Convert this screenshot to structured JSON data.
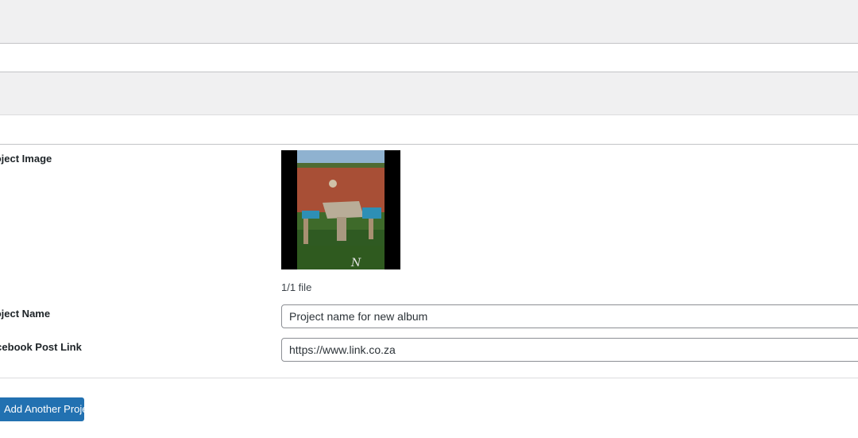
{
  "form": {
    "project_image_label": "Project Image",
    "file_count": "1/1 file",
    "project_name_label": "Project Name",
    "project_name_value": "Project name for new album",
    "facebook_link_label": "Facebook Post Link",
    "facebook_link_value": "https://www.link.co.za",
    "add_button_label": "Add Another Project"
  },
  "colors": {
    "accent": "#2271b1",
    "band": "#f0f0f1",
    "border": "#c3c4c7"
  },
  "icons": {
    "project_image": "project-image-thumbnail"
  }
}
